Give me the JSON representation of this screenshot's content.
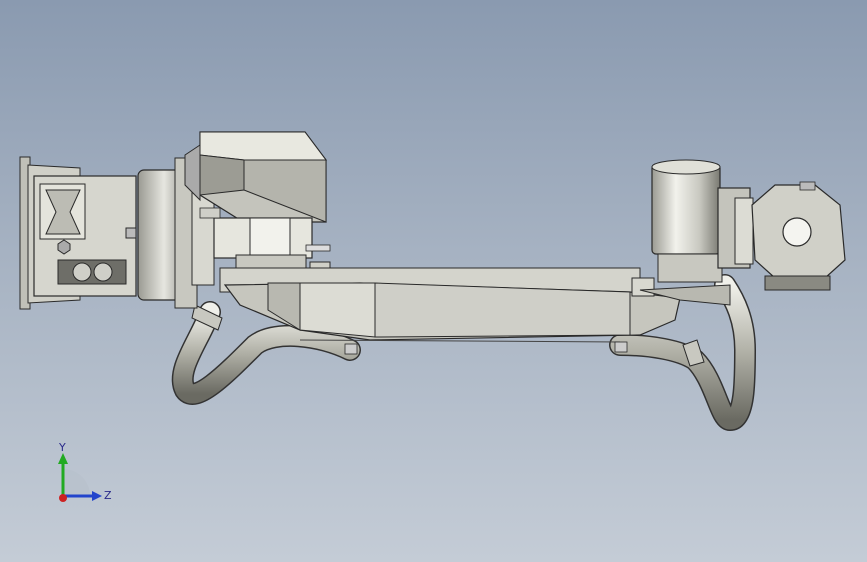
{
  "triad": {
    "y_label": "Y",
    "z_label": "Z"
  },
  "colors": {
    "metal_light": "#d8d8d0",
    "metal_mid": "#b8b8b0",
    "metal_dark": "#6e6e68",
    "outline": "#2a2a2a",
    "axis_y": "#22aa22",
    "axis_z": "#2244cc",
    "axis_x": "#cc2222"
  }
}
